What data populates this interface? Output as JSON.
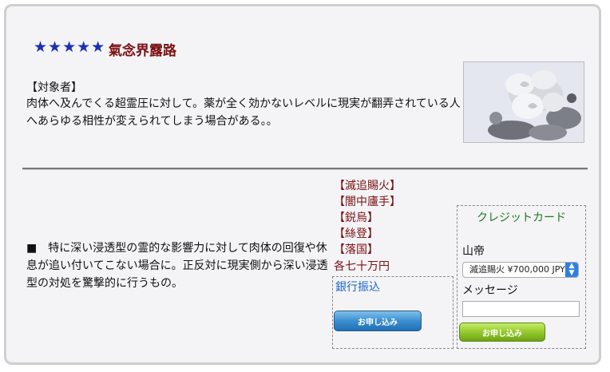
{
  "header": {
    "stars": "★★★★★",
    "title": "氣念界露路"
  },
  "target": {
    "heading": "【対象者】",
    "body": "肉体へ及んでくる超霊圧に対して。薬が全く効かないレベルに現実が翻弄されている人へあらゆる相性が変えられてしまう場合がある。。"
  },
  "description": "■　特に深い浸透型の霊的な影響力に対して肉体の回復や休息が追い付いてこない場合に。正反対に現実側から深い浸透型の対処を驚撃的に行うもの。",
  "artists": [
    "【滅追賜火】",
    "【闇中廬手】",
    "【鋭烏】",
    "【絲登】",
    "【落国】"
  ],
  "price": "各七十万円",
  "bank": {
    "label": "銀行振込",
    "button": "お申し込み"
  },
  "credit": {
    "title": "クレジットカード",
    "name": "山帝",
    "select_value": "滅追賜火 ¥700,000 JPY",
    "message_label": "メッセージ",
    "button": "お申し込み"
  },
  "icons": {
    "select_arrow": "chevron-updown-icon",
    "photo": "white-rose-photo"
  },
  "colors": {
    "title": "#7a1010",
    "stars": "#1a2fb8",
    "bank_label": "#1a64c8",
    "cc_title": "#1a7a1a"
  }
}
